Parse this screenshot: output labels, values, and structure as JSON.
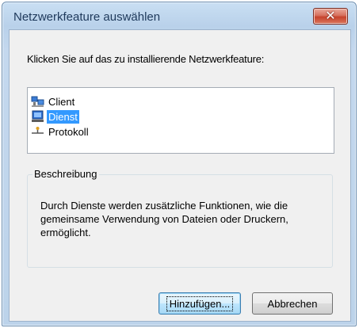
{
  "window": {
    "title": "Netzwerkfeature auswählen",
    "close_glyph": "✕"
  },
  "instruction": "Klicken Sie auf das zu installierende Netzwerkfeature:",
  "feature_list": {
    "items": [
      {
        "label": "Client",
        "icon": "client-icon",
        "selected": false
      },
      {
        "label": "Dienst",
        "icon": "service-icon",
        "selected": true
      },
      {
        "label": "Protokoll",
        "icon": "protocol-icon",
        "selected": false
      }
    ]
  },
  "description": {
    "title": "Beschreibung",
    "text": "Durch Dienste werden zusätzliche Funktionen, wie die gemeinsame Verwendung von Dateien oder Druckern, ermöglicht."
  },
  "buttons": {
    "add": "Hinzufügen...",
    "cancel": "Abbrechen"
  },
  "colors": {
    "selection": "#3399ff",
    "close_button": "#c7432c",
    "title_text": "#1e395b"
  }
}
